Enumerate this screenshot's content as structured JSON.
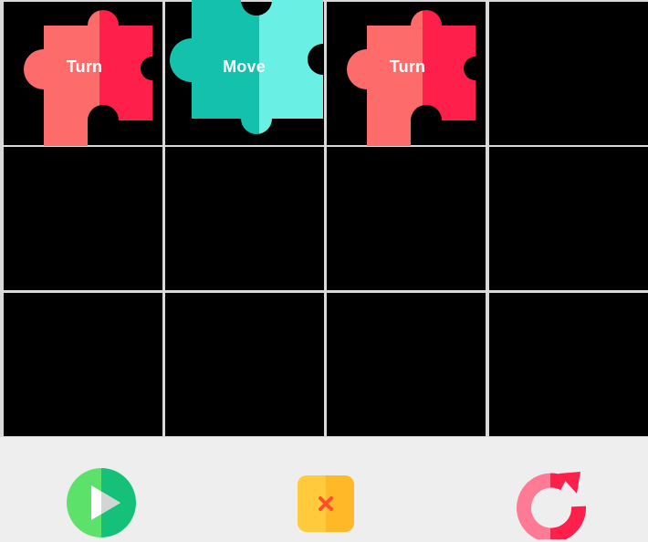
{
  "program": {
    "slots": [
      {
        "label": "Turn",
        "kind": "turn"
      },
      {
        "label": "Move",
        "kind": "move"
      },
      {
        "label": "Turn",
        "kind": "turn"
      },
      {
        "label": "",
        "kind": "empty"
      },
      {
        "label": "",
        "kind": "empty"
      },
      {
        "label": "",
        "kind": "empty"
      },
      {
        "label": "",
        "kind": "empty"
      },
      {
        "label": "",
        "kind": "empty"
      },
      {
        "label": "",
        "kind": "empty"
      },
      {
        "label": "",
        "kind": "empty"
      },
      {
        "label": "",
        "kind": "empty"
      },
      {
        "label": "",
        "kind": "empty"
      }
    ]
  },
  "toolbar": {
    "play_icon": "play-icon",
    "delete_icon": "delete-icon",
    "reset_icon": "reset-icon"
  },
  "colors": {
    "turn_light": "#fd6b6b",
    "turn_dark": "#ff1f4b",
    "move_dark": "#13c1ac",
    "move_light": "#6aefe4",
    "play_green": "#5ce26a",
    "play_dark": "#15c079",
    "delete_yellow": "#ffcb3d",
    "reset_red": "#ff1f4b",
    "reset_pink": "#ff7a94",
    "cell_bg": "#000000"
  }
}
